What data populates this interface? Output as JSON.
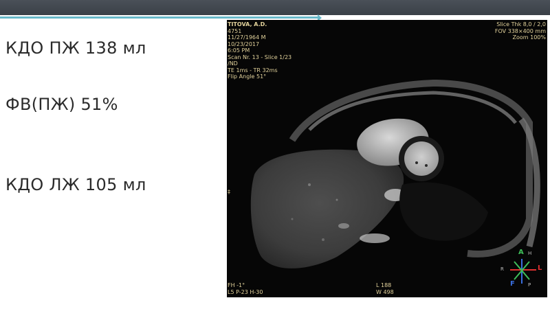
{
  "slide": {
    "lines": [
      "КДО ПЖ 138 мл",
      "ФВ(ПЖ) 51%",
      "КДО ЛЖ 105 мл"
    ]
  },
  "scan": {
    "top_left": [
      "TITOVA, A.D.",
      "4751",
      "11/27/1964  M",
      "10/23/2017",
      "6:05 PM",
      "Scan Nr. 13 - Slice 1/23",
      "/ND",
      "TE  1ms - TR  32ms",
      "Flip Angle 51°"
    ],
    "top_right": [
      "Slice Thk 8,0 / 2,0",
      "FOV 338×400 mm",
      "Zoom 100%"
    ],
    "bottom_left": [
      "FH -1°",
      "L5 P-23 H-30"
    ],
    "bottom_center": [
      "L 188",
      "W 498"
    ],
    "orientation": {
      "top": "A",
      "top_small": "H",
      "left": "R",
      "right": "L",
      "bottom": "F",
      "bottom_small": "P"
    },
    "left_marker": "‡",
    "colors": {
      "overlay_text": "#e3d39c",
      "orientation_red": "#e03030",
      "orientation_green": "#3fbf5a",
      "orientation_blue": "#3a6fe0"
    }
  }
}
